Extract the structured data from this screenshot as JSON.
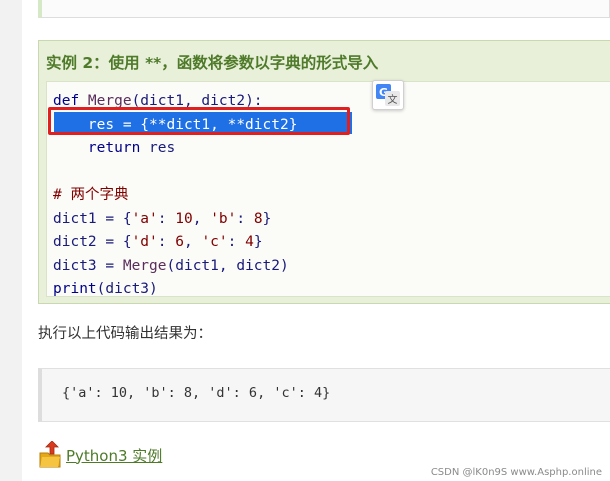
{
  "example": {
    "title": "实例 2：使用 **，函数将参数以字典的形式导入",
    "code_lines": [
      {
        "parts": [
          {
            "cls": "kw",
            "text": "def "
          },
          {
            "cls": "fn",
            "text": "Merge"
          },
          {
            "cls": "plain",
            "text": "(dict1, dict2):"
          }
        ]
      },
      {
        "parts": [
          {
            "cls": "sel-text",
            "text": "    res = {**dict1, **dict2}"
          }
        ]
      },
      {
        "parts": [
          {
            "cls": "plain",
            "text": "    "
          },
          {
            "cls": "kw",
            "text": "return"
          },
          {
            "cls": "plain",
            "text": " res"
          }
        ]
      },
      {
        "parts": []
      },
      {
        "parts": [
          {
            "cls": "cm",
            "text": "# 两个字典"
          }
        ]
      },
      {
        "parts": [
          {
            "cls": "plain",
            "text": "dict1 = {"
          },
          {
            "cls": "str",
            "text": "'a'"
          },
          {
            "cls": "plain",
            "text": ": "
          },
          {
            "cls": "num",
            "text": "10"
          },
          {
            "cls": "plain",
            "text": ", "
          },
          {
            "cls": "str",
            "text": "'b'"
          },
          {
            "cls": "plain",
            "text": ": "
          },
          {
            "cls": "num",
            "text": "8"
          },
          {
            "cls": "plain",
            "text": "}"
          }
        ]
      },
      {
        "parts": [
          {
            "cls": "plain",
            "text": "dict2 = {"
          },
          {
            "cls": "str",
            "text": "'d'"
          },
          {
            "cls": "plain",
            "text": ": "
          },
          {
            "cls": "num",
            "text": "6"
          },
          {
            "cls": "plain",
            "text": ", "
          },
          {
            "cls": "str",
            "text": "'c'"
          },
          {
            "cls": "plain",
            "text": ": "
          },
          {
            "cls": "num",
            "text": "4"
          },
          {
            "cls": "plain",
            "text": "}"
          }
        ]
      },
      {
        "parts": [
          {
            "cls": "plain",
            "text": "dict3 = "
          },
          {
            "cls": "fn",
            "text": "Merge"
          },
          {
            "cls": "plain",
            "text": "(dict1, dict2)"
          }
        ]
      },
      {
        "parts": [
          {
            "cls": "kw",
            "text": "print"
          },
          {
            "cls": "plain",
            "text": "(dict3)"
          }
        ]
      }
    ]
  },
  "translate_button": {
    "icon": "google-translate-icon"
  },
  "output": {
    "label": "执行以上代码输出结果为：",
    "text": "{'a': 10, 'b': 8, 'd': 6, 'c': 4}"
  },
  "python_link": {
    "icon": "up-arrow-folder-icon",
    "text": "Python3 实例"
  },
  "watermark": "CSDN @lK0n9S   www.Asphp.online",
  "colors": {
    "title_green": "#4e7a29",
    "example_bg": "#e8f0da",
    "selection_blue": "#1f6fe5",
    "highlight_red": "#e02020"
  }
}
